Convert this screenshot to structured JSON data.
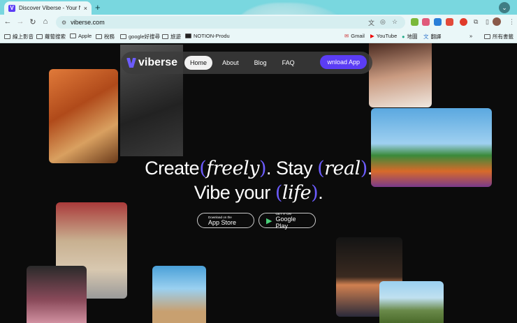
{
  "browser": {
    "tab_title": "Discover Viberse - Your New",
    "tab_close": "×",
    "new_tab": "+",
    "url": "viberse.com",
    "bookmarks": [
      "線上影音",
      "蘿蔔搜索",
      "Apple",
      "稅務",
      "google好搜尋",
      "旅遊",
      "NOTION-Produ",
      "Gmail",
      "YouTube",
      "地圖",
      "翻譯"
    ],
    "all_bookmarks": "所有書籤",
    "more": "»"
  },
  "nav": {
    "logo": "viberse",
    "items": [
      "Home",
      "About",
      "Blog",
      "FAQ"
    ],
    "download": "wnload App"
  },
  "hero": {
    "line1_a": "Create",
    "line1_b": "freely",
    "line1_c": ". Stay",
    "line1_d": "real",
    "line1_e": ".",
    "line2_a": "Vibe your",
    "line2_b": "life",
    "line2_c": "."
  },
  "stores": {
    "apple_small": "Download on the",
    "apple_big": "App Store",
    "google_small": "GET IT ON",
    "google_big": "Google Play"
  },
  "colors": {
    "accent": "#6c5cff",
    "chrome": "#79d7df"
  }
}
